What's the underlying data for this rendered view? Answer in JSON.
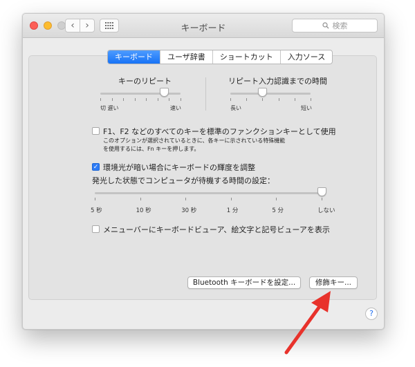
{
  "window": {
    "title": "キーボード",
    "search_placeholder": "検索"
  },
  "tabs": [
    {
      "label": "キーボード",
      "active": true
    },
    {
      "label": "ユーザ辞書",
      "active": false
    },
    {
      "label": "ショートカット",
      "active": false
    },
    {
      "label": "入力ソース",
      "active": false
    }
  ],
  "key_repeat": {
    "title": "キーのリピート",
    "min_label": "切 遅い",
    "max_label": "速い",
    "value": 0.8
  },
  "delay_until_repeat": {
    "title": "リピート入力認識までの時間",
    "min_label": "長い",
    "max_label": "短い",
    "value": 0.4
  },
  "fn_keys": {
    "label": "F1、F2 などのすべてのキーを標準のファンクションキーとして使用",
    "note_line1": "このオプションが選択されているときに、各キーに示されている特殊機能",
    "note_line2": "を使用するには、Fn キーを押します。",
    "checked": false
  },
  "brightness": {
    "label": "環境光が暗い場合にキーボードの輝度を調整",
    "checked": true
  },
  "backlight_idle": {
    "title": "発光した状態でコンピュータが待機する時間の設定：",
    "ticks": [
      "5 秒",
      "10 秒",
      "30 秒",
      "1 分",
      "5 分",
      "しない"
    ],
    "value_index": 5
  },
  "viewers": {
    "label": "メニューバーにキーボードビューア、絵文字と記号ビューアを表示",
    "checked": false
  },
  "buttons": {
    "bluetooth": "Bluetooth キーボードを設定...",
    "modifier": "修飾キー..."
  },
  "help_label": "?",
  "colors": {
    "accent": "#1b73f6",
    "annotation_arrow": "#e8322b"
  }
}
